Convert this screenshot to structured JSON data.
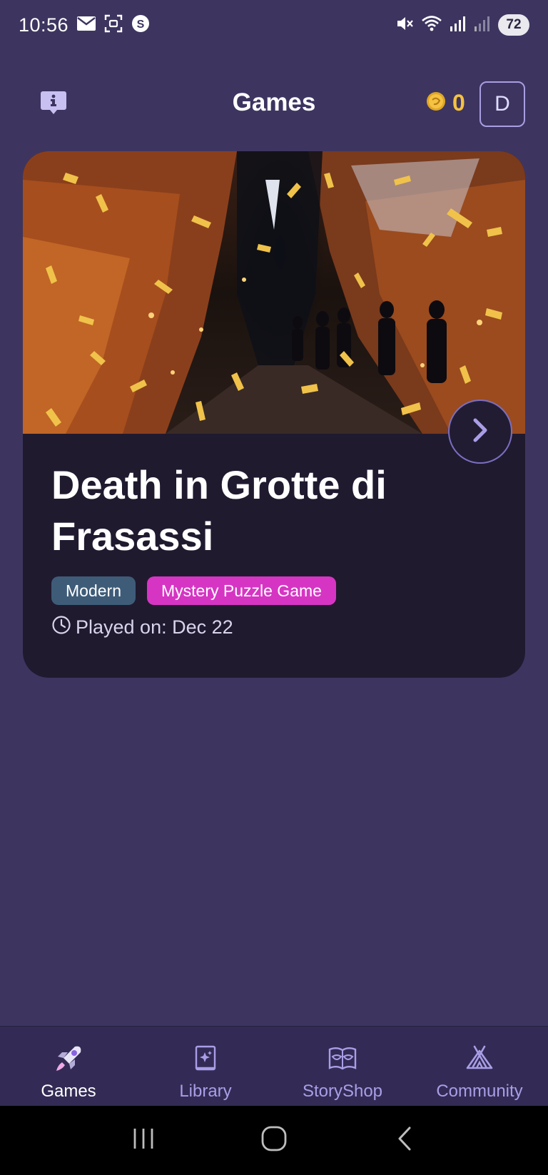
{
  "status_bar": {
    "time": "10:56",
    "battery": "72",
    "left_icons": [
      "mail-icon",
      "screenshot-icon",
      "s-app-icon"
    ],
    "right_icons": [
      "mute-icon",
      "wifi-icon",
      "signal-icon",
      "signal-weak-icon"
    ]
  },
  "header": {
    "title": "Games",
    "coin_count": "0",
    "avatar_initial": "D",
    "info_icon": "info-chat-icon"
  },
  "game_card": {
    "title": "Death in Grotte di Frasassi",
    "tags": [
      {
        "label": "Modern",
        "color": "#3e5c78"
      },
      {
        "label": "Mystery Puzzle Game",
        "color": "#d635c4"
      }
    ],
    "played_on": "Played on: Dec 22"
  },
  "bottom_nav": {
    "items": [
      {
        "label": "Games",
        "icon": "rocket-icon",
        "active": true
      },
      {
        "label": "Library",
        "icon": "book-sparkle-icon",
        "active": false
      },
      {
        "label": "StoryShop",
        "icon": "open-book-mask-icon",
        "active": false
      },
      {
        "label": "Community",
        "icon": "tent-icon",
        "active": false
      }
    ]
  },
  "colors": {
    "background": "#3d3560",
    "card": "#201a2f",
    "accent": "#a99ee6",
    "coin": "#f5c242"
  }
}
